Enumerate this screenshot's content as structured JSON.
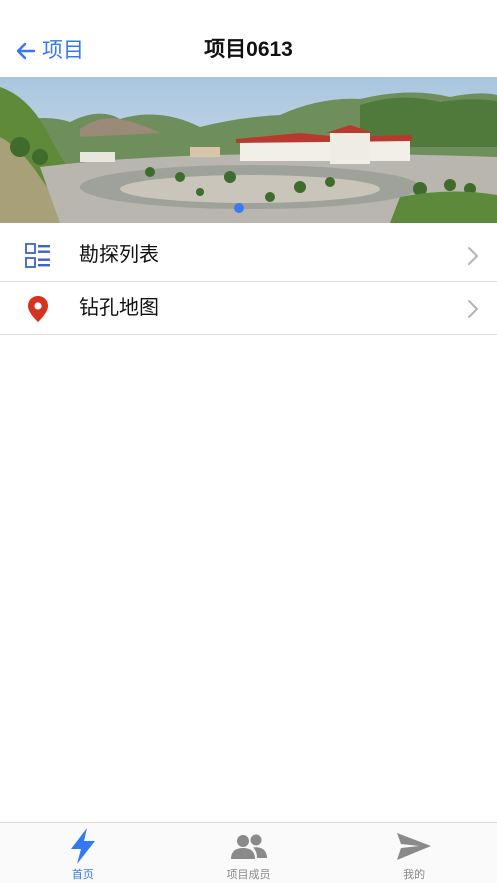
{
  "navbar": {
    "back_label": "项目",
    "title": "项目0613"
  },
  "banner": {
    "image": "campus-landscape-photo",
    "page_count": 1,
    "active_page": 1
  },
  "menu": {
    "items": [
      {
        "label": "勘探列表",
        "icon": "list-icon"
      },
      {
        "label": "钻孔地图",
        "icon": "map-pin-icon"
      }
    ]
  },
  "tabbar": {
    "tabs": [
      {
        "label": "首页",
        "icon": "lightning-icon",
        "active": true
      },
      {
        "label": "项目成员",
        "icon": "users-icon",
        "active": false
      },
      {
        "label": "我的",
        "icon": "send-icon",
        "active": false
      }
    ]
  },
  "colors": {
    "accent": "#3478f6",
    "pin": "#d6331f",
    "inactive": "#8a8a8a"
  }
}
